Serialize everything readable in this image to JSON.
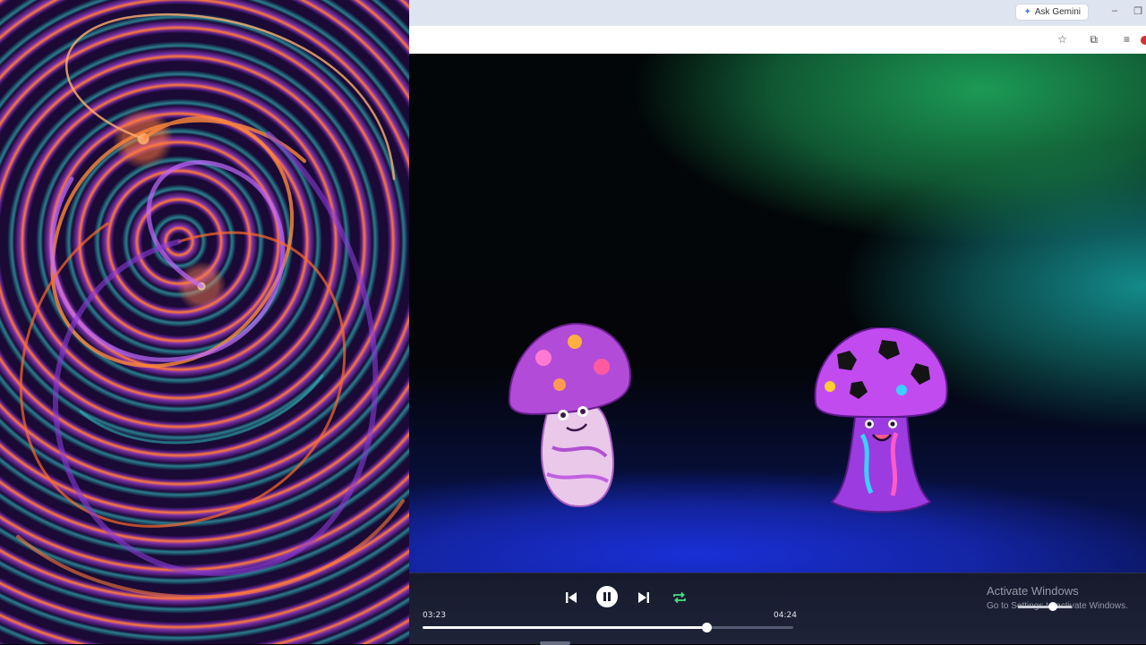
{
  "browser": {
    "gemini_label": "Ask Gemini",
    "window_min": "–",
    "window_max": "❐"
  },
  "icons": {
    "star": "☆",
    "extensions": "⧉",
    "media": "≡",
    "gemini_spark": "✦"
  },
  "player": {
    "current_time": "03:23",
    "total_time": "04:24",
    "progress": 0.766,
    "volume": 0.6
  },
  "watermark": {
    "title": "Activate Windows",
    "subtitle": "Go to Settings to activate Windows."
  },
  "colors": {
    "accent": "#4ade80",
    "player_bg": "#1a1e30"
  }
}
